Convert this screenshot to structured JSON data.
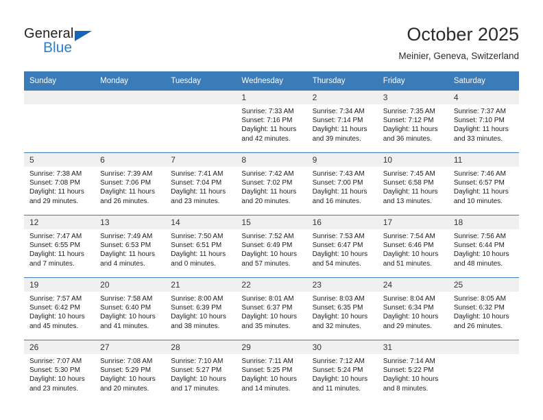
{
  "brand": {
    "name_top": "General",
    "name_bottom": "Blue",
    "accent_color": "#2a7fd4",
    "triangle_color": "#1565b8"
  },
  "header": {
    "month_title": "October 2025",
    "location": "Meinier, Geneva, Switzerland"
  },
  "theme": {
    "header_blue": "#3b7cb8",
    "daynum_bg": "#f0f0f0",
    "text": "#1a1a1a"
  },
  "weekday_headers": [
    "Sunday",
    "Monday",
    "Tuesday",
    "Wednesday",
    "Thursday",
    "Friday",
    "Saturday"
  ],
  "weeks": [
    [
      {
        "day": "",
        "sunrise": "",
        "sunset": "",
        "daylight1": "",
        "daylight2": "",
        "empty": true
      },
      {
        "day": "",
        "sunrise": "",
        "sunset": "",
        "daylight1": "",
        "daylight2": "",
        "empty": true
      },
      {
        "day": "",
        "sunrise": "",
        "sunset": "",
        "daylight1": "",
        "daylight2": "",
        "empty": true
      },
      {
        "day": "1",
        "sunrise": "Sunrise: 7:33 AM",
        "sunset": "Sunset: 7:16 PM",
        "daylight1": "Daylight: 11 hours",
        "daylight2": "and 42 minutes."
      },
      {
        "day": "2",
        "sunrise": "Sunrise: 7:34 AM",
        "sunset": "Sunset: 7:14 PM",
        "daylight1": "Daylight: 11 hours",
        "daylight2": "and 39 minutes."
      },
      {
        "day": "3",
        "sunrise": "Sunrise: 7:35 AM",
        "sunset": "Sunset: 7:12 PM",
        "daylight1": "Daylight: 11 hours",
        "daylight2": "and 36 minutes."
      },
      {
        "day": "4",
        "sunrise": "Sunrise: 7:37 AM",
        "sunset": "Sunset: 7:10 PM",
        "daylight1": "Daylight: 11 hours",
        "daylight2": "and 33 minutes."
      }
    ],
    [
      {
        "day": "5",
        "sunrise": "Sunrise: 7:38 AM",
        "sunset": "Sunset: 7:08 PM",
        "daylight1": "Daylight: 11 hours",
        "daylight2": "and 29 minutes."
      },
      {
        "day": "6",
        "sunrise": "Sunrise: 7:39 AM",
        "sunset": "Sunset: 7:06 PM",
        "daylight1": "Daylight: 11 hours",
        "daylight2": "and 26 minutes."
      },
      {
        "day": "7",
        "sunrise": "Sunrise: 7:41 AM",
        "sunset": "Sunset: 7:04 PM",
        "daylight1": "Daylight: 11 hours",
        "daylight2": "and 23 minutes."
      },
      {
        "day": "8",
        "sunrise": "Sunrise: 7:42 AM",
        "sunset": "Sunset: 7:02 PM",
        "daylight1": "Daylight: 11 hours",
        "daylight2": "and 20 minutes."
      },
      {
        "day": "9",
        "sunrise": "Sunrise: 7:43 AM",
        "sunset": "Sunset: 7:00 PM",
        "daylight1": "Daylight: 11 hours",
        "daylight2": "and 16 minutes."
      },
      {
        "day": "10",
        "sunrise": "Sunrise: 7:45 AM",
        "sunset": "Sunset: 6:58 PM",
        "daylight1": "Daylight: 11 hours",
        "daylight2": "and 13 minutes."
      },
      {
        "day": "11",
        "sunrise": "Sunrise: 7:46 AM",
        "sunset": "Sunset: 6:57 PM",
        "daylight1": "Daylight: 11 hours",
        "daylight2": "and 10 minutes."
      }
    ],
    [
      {
        "day": "12",
        "sunrise": "Sunrise: 7:47 AM",
        "sunset": "Sunset: 6:55 PM",
        "daylight1": "Daylight: 11 hours",
        "daylight2": "and 7 minutes."
      },
      {
        "day": "13",
        "sunrise": "Sunrise: 7:49 AM",
        "sunset": "Sunset: 6:53 PM",
        "daylight1": "Daylight: 11 hours",
        "daylight2": "and 4 minutes."
      },
      {
        "day": "14",
        "sunrise": "Sunrise: 7:50 AM",
        "sunset": "Sunset: 6:51 PM",
        "daylight1": "Daylight: 11 hours",
        "daylight2": "and 0 minutes."
      },
      {
        "day": "15",
        "sunrise": "Sunrise: 7:52 AM",
        "sunset": "Sunset: 6:49 PM",
        "daylight1": "Daylight: 10 hours",
        "daylight2": "and 57 minutes."
      },
      {
        "day": "16",
        "sunrise": "Sunrise: 7:53 AM",
        "sunset": "Sunset: 6:47 PM",
        "daylight1": "Daylight: 10 hours",
        "daylight2": "and 54 minutes."
      },
      {
        "day": "17",
        "sunrise": "Sunrise: 7:54 AM",
        "sunset": "Sunset: 6:46 PM",
        "daylight1": "Daylight: 10 hours",
        "daylight2": "and 51 minutes."
      },
      {
        "day": "18",
        "sunrise": "Sunrise: 7:56 AM",
        "sunset": "Sunset: 6:44 PM",
        "daylight1": "Daylight: 10 hours",
        "daylight2": "and 48 minutes."
      }
    ],
    [
      {
        "day": "19",
        "sunrise": "Sunrise: 7:57 AM",
        "sunset": "Sunset: 6:42 PM",
        "daylight1": "Daylight: 10 hours",
        "daylight2": "and 45 minutes."
      },
      {
        "day": "20",
        "sunrise": "Sunrise: 7:58 AM",
        "sunset": "Sunset: 6:40 PM",
        "daylight1": "Daylight: 10 hours",
        "daylight2": "and 41 minutes."
      },
      {
        "day": "21",
        "sunrise": "Sunrise: 8:00 AM",
        "sunset": "Sunset: 6:39 PM",
        "daylight1": "Daylight: 10 hours",
        "daylight2": "and 38 minutes."
      },
      {
        "day": "22",
        "sunrise": "Sunrise: 8:01 AM",
        "sunset": "Sunset: 6:37 PM",
        "daylight1": "Daylight: 10 hours",
        "daylight2": "and 35 minutes."
      },
      {
        "day": "23",
        "sunrise": "Sunrise: 8:03 AM",
        "sunset": "Sunset: 6:35 PM",
        "daylight1": "Daylight: 10 hours",
        "daylight2": "and 32 minutes."
      },
      {
        "day": "24",
        "sunrise": "Sunrise: 8:04 AM",
        "sunset": "Sunset: 6:34 PM",
        "daylight1": "Daylight: 10 hours",
        "daylight2": "and 29 minutes."
      },
      {
        "day": "25",
        "sunrise": "Sunrise: 8:05 AM",
        "sunset": "Sunset: 6:32 PM",
        "daylight1": "Daylight: 10 hours",
        "daylight2": "and 26 minutes."
      }
    ],
    [
      {
        "day": "26",
        "sunrise": "Sunrise: 7:07 AM",
        "sunset": "Sunset: 5:30 PM",
        "daylight1": "Daylight: 10 hours",
        "daylight2": "and 23 minutes."
      },
      {
        "day": "27",
        "sunrise": "Sunrise: 7:08 AM",
        "sunset": "Sunset: 5:29 PM",
        "daylight1": "Daylight: 10 hours",
        "daylight2": "and 20 minutes."
      },
      {
        "day": "28",
        "sunrise": "Sunrise: 7:10 AM",
        "sunset": "Sunset: 5:27 PM",
        "daylight1": "Daylight: 10 hours",
        "daylight2": "and 17 minutes."
      },
      {
        "day": "29",
        "sunrise": "Sunrise: 7:11 AM",
        "sunset": "Sunset: 5:25 PM",
        "daylight1": "Daylight: 10 hours",
        "daylight2": "and 14 minutes."
      },
      {
        "day": "30",
        "sunrise": "Sunrise: 7:12 AM",
        "sunset": "Sunset: 5:24 PM",
        "daylight1": "Daylight: 10 hours",
        "daylight2": "and 11 minutes."
      },
      {
        "day": "31",
        "sunrise": "Sunrise: 7:14 AM",
        "sunset": "Sunset: 5:22 PM",
        "daylight1": "Daylight: 10 hours",
        "daylight2": "and 8 minutes."
      },
      {
        "day": "",
        "sunrise": "",
        "sunset": "",
        "daylight1": "",
        "daylight2": "",
        "empty": true
      }
    ]
  ]
}
